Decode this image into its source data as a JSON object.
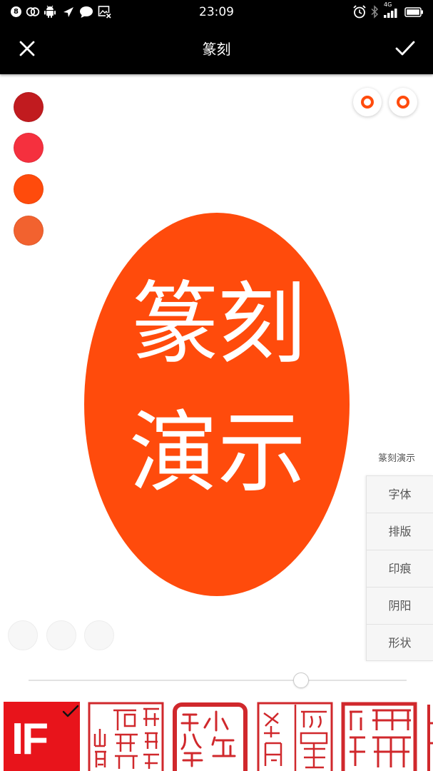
{
  "status_bar": {
    "time": "23:09",
    "badge_count": "8",
    "network_type": "4G",
    "left_icons": [
      "badge-icon",
      "loop-icon",
      "android-icon",
      "navigation-icon",
      "chat-icon",
      "image-blocked-icon"
    ],
    "right_icons": [
      "alarm-icon",
      "bluetooth-icon",
      "signal-icon",
      "battery-icon"
    ]
  },
  "header": {
    "title": "篆刻",
    "left_icon": "close-icon",
    "right_icon": "check-icon"
  },
  "color_swatches": [
    "#C11B1F",
    "#F5303E",
    "#FF4B0C",
    "#F2622F"
  ],
  "top_right_buttons": [
    {
      "icon": "ring-icon",
      "color": "#FF4B0C"
    },
    {
      "icon": "ring-icon",
      "color": "#FF4B0C"
    }
  ],
  "seal_preview": {
    "fill": "#FF4B0C",
    "text_color": "#FFFFFF",
    "chars": [
      "篆",
      "刻",
      "演",
      "示"
    ]
  },
  "menu": {
    "title": "篆刻演示",
    "items": [
      "字体",
      "排版",
      "印痕",
      "阴阳",
      "形状"
    ]
  },
  "slider": {
    "value": 0.72
  },
  "seal_styles": [
    {
      "logo_text": "IF",
      "selected": true,
      "color": "#E8141B"
    },
    {
      "selected": false,
      "color": "#D0282C"
    },
    {
      "selected": false,
      "color": "#D0282C"
    },
    {
      "selected": false,
      "color": "#D0282C"
    },
    {
      "selected": false,
      "color": "#D0282C"
    },
    {
      "selected": false,
      "color": "#D0282C"
    }
  ]
}
